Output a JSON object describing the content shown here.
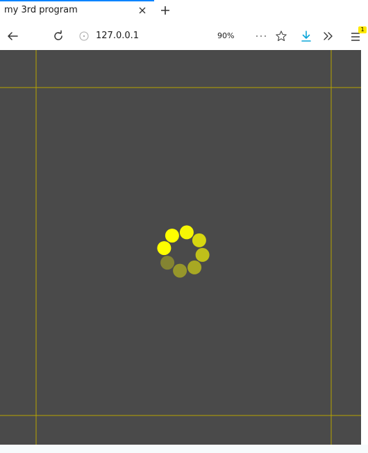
{
  "tab": {
    "title": "my 3rd program"
  },
  "navbar": {
    "url": "127.0.0.1",
    "zoom": "90%",
    "menu_badge": "1"
  },
  "colors": {
    "page_background": "#4a4a4a",
    "guide_lines": "#b8a400",
    "spinner": "#ffff00",
    "tab_accent": "#0a84ff",
    "download_accent": "#0aa5d9"
  },
  "spinner": {
    "dot_count": 8,
    "dot_opacities": [
      1.0,
      1.0,
      0.95,
      0.78,
      0.65,
      0.52,
      0.42,
      0.32
    ]
  },
  "icons": {
    "tab_close": "close-icon",
    "new_tab": "plus-icon",
    "back": "arrow-left-icon",
    "reload": "reload-icon",
    "site_info": "info-circle-icon",
    "page_actions": "ellipsis-icon",
    "bookmark": "star-icon",
    "downloads": "download-icon",
    "overflow": "chevrons-right-icon",
    "menu": "hamburger-menu-icon"
  }
}
